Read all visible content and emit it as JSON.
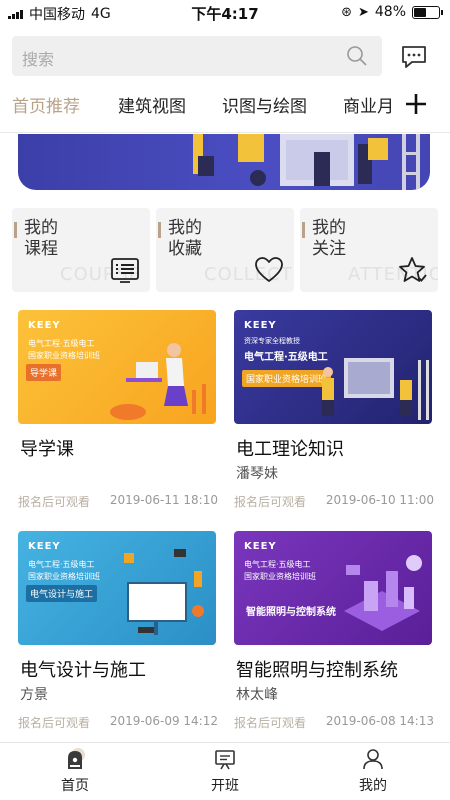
{
  "status": {
    "carrier": "中国移动",
    "network": "4G",
    "time": "下午4:17",
    "battery": "48%"
  },
  "search": {
    "placeholder": "搜索"
  },
  "tabs": [
    "首页推荐",
    "建筑视图",
    "识图与绘图",
    "商业月"
  ],
  "quick": [
    {
      "line1": "我的",
      "line2": "课程",
      "watermark": "COURSE",
      "icon": "list-icon"
    },
    {
      "line1": "我的",
      "line2": "收藏",
      "watermark": "COLLECT",
      "icon": "heart-icon"
    },
    {
      "line1": "我的",
      "line2": "关注",
      "watermark": "ATTENTION",
      "icon": "star-icon"
    }
  ],
  "courses": [
    {
      "title": "导学课",
      "author": "",
      "signup": "报名后可观看",
      "date": "2019-06-11 18:10",
      "thumb": {
        "brand": "KEEY",
        "line1": "电气工程·五级电工",
        "line2": "国家职业资格培训班",
        "tag": "导学课",
        "bg": "#fbb32b"
      }
    },
    {
      "title": "电工理论知识",
      "author": "潘琴妹",
      "signup": "报名后可观看",
      "date": "2019-06-10 11:00",
      "thumb": {
        "brand": "KEEY",
        "line1": "资深专家全程教授",
        "line2": "电气工程·五级电工",
        "tag": "国家职业资格培训班",
        "bg": "#2f2f8a"
      }
    },
    {
      "title": "电气设计与施工",
      "author": "方景",
      "signup": "报名后可观看",
      "date": "2019-06-09 14:12",
      "thumb": {
        "brand": "KEEY",
        "line1": "电气工程·五级电工",
        "line2": "国家职业资格培训班",
        "tag": "电气设计与施工",
        "bg": "#3aa6d8"
      }
    },
    {
      "title": "智能照明与控制系统",
      "author": "林太峰",
      "signup": "报名后可观看",
      "date": "2019-06-08 14:13",
      "thumb": {
        "brand": "KEEY",
        "line1": "电气工程·五级电工",
        "line2": "国家职业资格培训班",
        "tag": "智能照明与控制系统",
        "bg": "#6f2aa8"
      }
    }
  ],
  "nav": [
    {
      "label": "首页",
      "icon": "home-icon",
      "active": true
    },
    {
      "label": "开班",
      "icon": "class-board-icon",
      "active": false
    },
    {
      "label": "我的",
      "icon": "profile-icon",
      "active": false
    }
  ],
  "colors": {
    "accent": "#b8a389"
  }
}
